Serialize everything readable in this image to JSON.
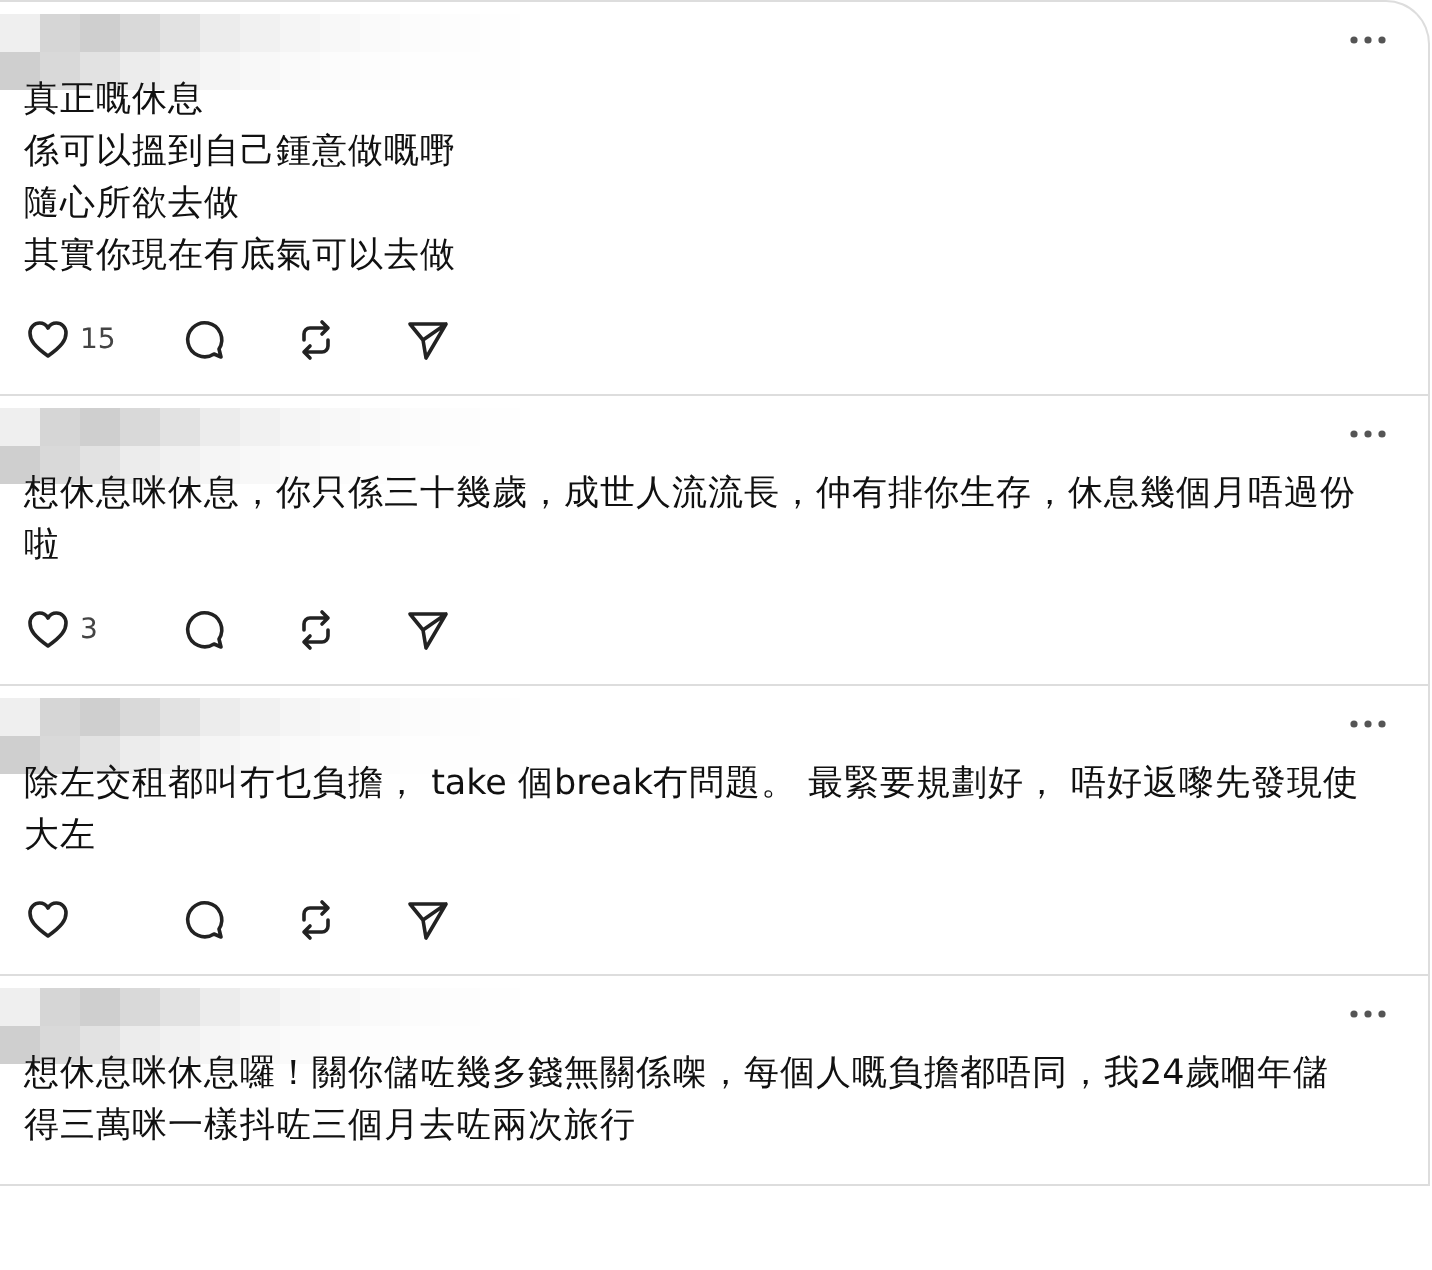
{
  "posts": [
    {
      "lines": [
        "真正嘅休息",
        "係可以搵到自己鍾意做嘅嘢",
        "隨心所欲去做",
        "其實你現在有底氣可以去做"
      ],
      "likes": "15",
      "actions_visible": true
    },
    {
      "text": "想休息咪休息，你只係三十幾歲，成世人流流長，仲有排你生存，休息幾個月唔過份啦",
      "likes": "3",
      "actions_visible": true
    },
    {
      "text": "除左交租都叫冇乜負擔， take 個break冇問題。 最緊要規劃好， 唔好返嚟先發現使大左",
      "actions_visible": true
    },
    {
      "text": "想休息咪休息囉！關你儲咗幾多錢無關係㗎，每個人嘅負擔都唔同，我24歲嗰年儲得三萬咪一樣抖咗三個月去咗兩次旅行",
      "actions_visible": false
    }
  ]
}
